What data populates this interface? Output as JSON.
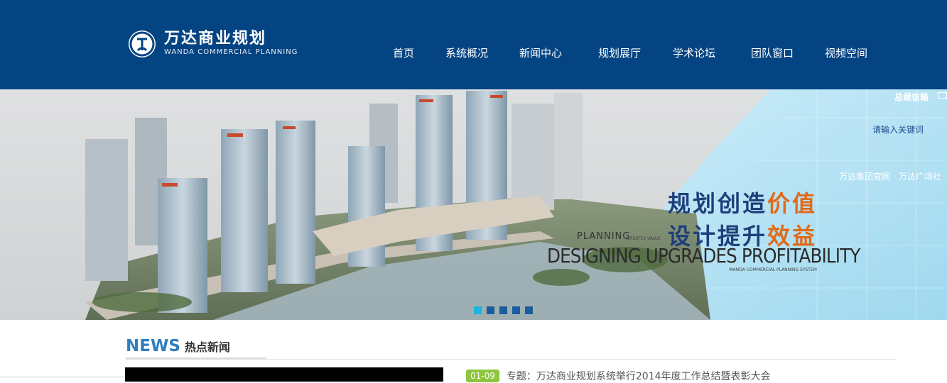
{
  "header": {
    "logo_cn": "万达商业规划",
    "logo_en": "WANDA COMMERCIAL PLANNING",
    "nav": [
      "首页",
      "系统概况",
      "新闻中心",
      "规划展厅",
      "学术论坛",
      "团队窗口",
      "视频空间"
    ]
  },
  "banner": {
    "slogan_line1_a": "规划创造",
    "slogan_line1_b": "价值",
    "slogan_line2_a": "设计提升",
    "slogan_line2_b": "效益",
    "en_planning": "PLANNING",
    "en_creates": "CREATES VALUE",
    "en_big": "DESIGNING UPGRADES PROFITABILITY",
    "en_system": "WANDA COMMERCIAL PLANNING SYSTEM",
    "dots": 5,
    "active_dot": 1
  },
  "utility": {
    "mailbox_label": "总裁信箱",
    "search_placeholder": "请输入关键词",
    "links": [
      "万达集团官网",
      "万达广场社"
    ]
  },
  "news": {
    "title_en": "NEWS",
    "title_cn": "热点新闻",
    "items": [
      {
        "date": "01-09",
        "title": "专题：万达商业规划系统举行2014年度工作总结暨表彰大会"
      }
    ]
  },
  "colors": {
    "header_bg": "#044482",
    "accent_blue": "#2e7fc1",
    "badge_green": "#8dc63f",
    "slogan_orange": "#e06b1a"
  }
}
